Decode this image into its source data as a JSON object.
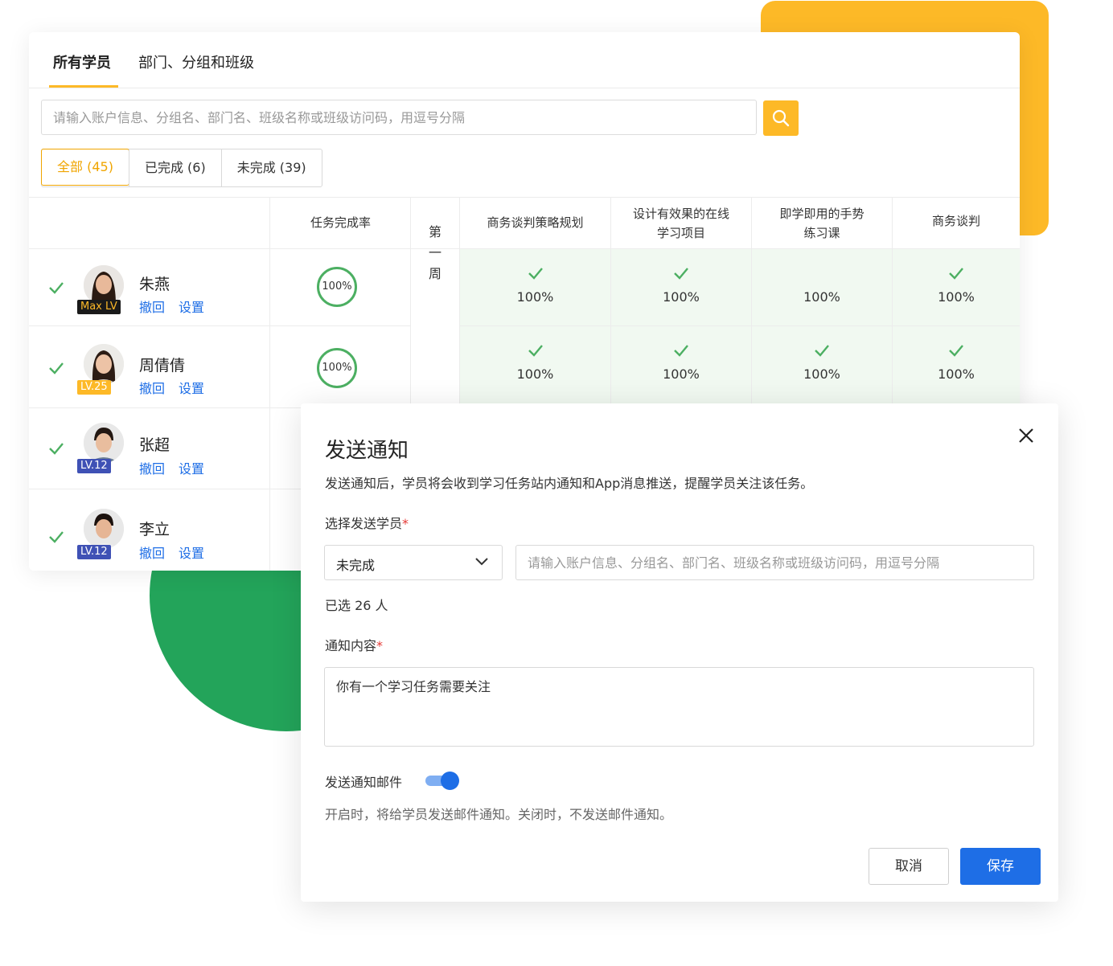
{
  "tabs": [
    {
      "label": "所有学员",
      "active": true
    },
    {
      "label": "部门、分组和班级",
      "active": false
    }
  ],
  "search": {
    "placeholder": "请输入账户信息、分组名、部门名、班级名称或班级访问码，用逗号分隔"
  },
  "filters": [
    {
      "label": "全部 (45)",
      "active": true
    },
    {
      "label": "已完成 (6)",
      "active": false
    },
    {
      "label": "未完成 (39)",
      "active": false
    }
  ],
  "table": {
    "completion_header": "任务完成率",
    "week_label": "第\n一\n周",
    "columns": [
      "商务谈判策略规划",
      "设计有效果的在线\n学习项目",
      "即学即用的手势\n练习课",
      "商务谈判"
    ],
    "actions": {
      "revoke": "撤回",
      "settings": "设置"
    },
    "rows": [
      {
        "name": "朱燕",
        "level": "Max LV",
        "level_color": "#1a1a1a",
        "level_text_color": "#FDB927",
        "rate": "100%",
        "cells": [
          {
            "check": true,
            "value": "100%"
          },
          {
            "check": true,
            "value": "100%"
          },
          {
            "check": false,
            "value": "100%"
          },
          {
            "check": true,
            "value": "100%"
          }
        ]
      },
      {
        "name": "周倩倩",
        "level": "LV.25",
        "level_color": "#FDB927",
        "level_text_color": "#ffffff",
        "rate": "100%",
        "cells": [
          {
            "check": true,
            "value": "100%"
          },
          {
            "check": true,
            "value": "100%"
          },
          {
            "check": true,
            "value": "100%"
          },
          {
            "check": true,
            "value": "100%"
          }
        ]
      },
      {
        "name": "张超",
        "level": "LV.12",
        "level_color": "#3F51B5",
        "level_text_color": "#ffffff"
      },
      {
        "name": "李立",
        "level": "LV.12",
        "level_color": "#3F51B5",
        "level_text_color": "#ffffff"
      }
    ]
  },
  "modal": {
    "title": "发送通知",
    "description": "发送通知后，学员将会收到学习任务站内通知和App消息推送，提醒学员关注该任务。",
    "select_label": "选择发送学员",
    "required_mark": "*",
    "select_value": "未完成",
    "search_placeholder": "请输入账户信息、分组名、部门名、班级名称或班级访问码，用逗号分隔",
    "selected_count": "已选 26 人",
    "content_label": "通知内容",
    "content_value": "你有一个学习任务需要关注",
    "email_label": "发送通知邮件",
    "email_enabled": true,
    "email_hint": "开启时，将给学员发送邮件通知。关闭时，不发送邮件通知。",
    "cancel_label": "取消",
    "save_label": "保存"
  },
  "colors": {
    "accent": "#FDB927",
    "primary": "#1E6EE6",
    "success": "#4CAF62",
    "decoration_green": "#23A45A"
  }
}
